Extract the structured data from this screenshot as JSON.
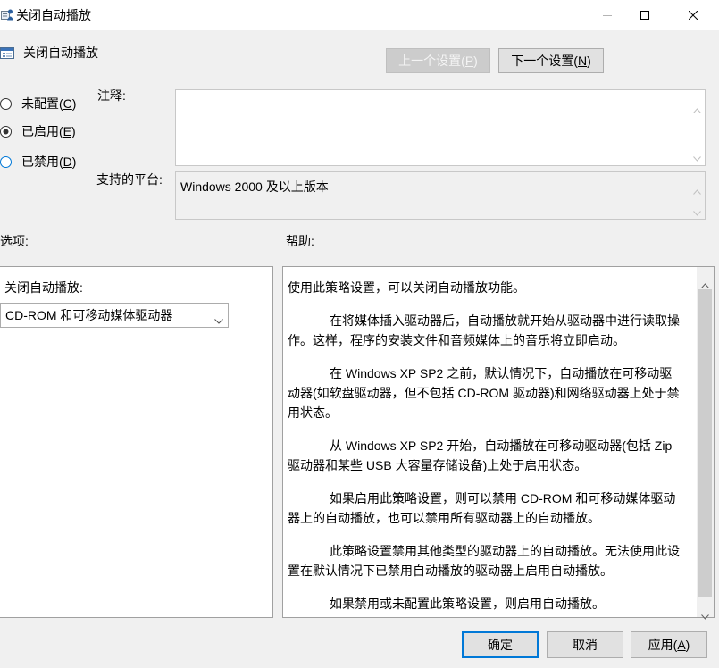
{
  "window": {
    "title": "关闭自动播放",
    "icon": "group-policy-icon",
    "controls": [
      "minimize-icon",
      "maximize-icon",
      "close-icon"
    ]
  },
  "header": {
    "icon": "policy-setting-icon",
    "policy_name": "关闭自动播放",
    "prev_button": "上一个设置(P)",
    "prev_enabled": false,
    "next_button": "下一个设置(N)"
  },
  "state": {
    "options": [
      {
        "label": "未配置(C)",
        "checked": false
      },
      {
        "label": "已启用(E)",
        "checked": true
      },
      {
        "label": "已禁用(D)",
        "checked": false
      }
    ]
  },
  "comment": {
    "label": "注释:",
    "value": ""
  },
  "platform": {
    "label": "支持的平台:",
    "value": "Windows 2000 及以上版本"
  },
  "options_panel": {
    "label": "选项:",
    "field_label": "关闭自动播放:",
    "selected": "CD-ROM 和可移动媒体驱动器"
  },
  "help_panel": {
    "label": "帮助:",
    "paragraphs": [
      [
        "使用此策略设置，可以关闭自动播放功能。"
      ],
      [
        "在将媒体插入驱动器后，自动播放就开始从驱动器中进行读取操",
        "作。这样，程序的安装文件和音频媒体上的音乐将立即启动。"
      ],
      [
        "在 Windows XP SP2 之前，默认情况下，自动播放在可移动驱",
        "动器(如软盘驱动器，但不包括 CD-ROM 驱动器)和网络驱动器上处于禁",
        "用状态。"
      ],
      [
        "从 Windows XP SP2 开始，自动播放在可移动驱动器(包括 Zip",
        "驱动器和某些 USB 大容量存储设备)上处于启用状态。"
      ],
      [
        "如果启用此策略设置，则可以禁用 CD-ROM 和可移动媒体驱动",
        "器上的自动播放，也可以禁用所有驱动器上的自动播放。"
      ],
      [
        "此策略设置禁用其他类型的驱动器上的自动播放。无法使用此设",
        "置在默认情况下已禁用自动播放的驱动器上启用自动播放。"
      ],
      [
        "如果禁用或未配置此策略设置，则启用自动播放。"
      ]
    ]
  },
  "footer": {
    "ok": "确定",
    "cancel": "取消",
    "apply": "应用(A)"
  },
  "colors": {
    "accent": "#0078d7",
    "dialog_bg": "#f0f0f0",
    "button_bg": "#e1e1e1"
  }
}
